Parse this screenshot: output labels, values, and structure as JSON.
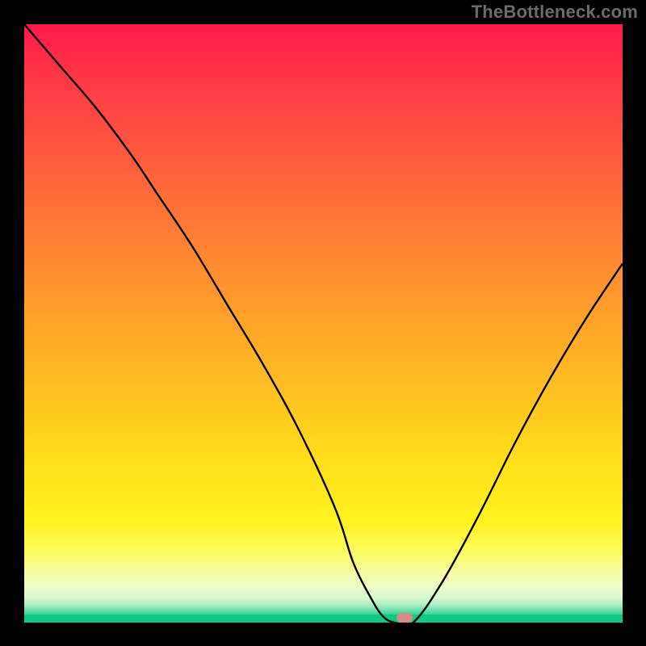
{
  "watermark": "TheBottleneck.com",
  "chart_data": {
    "type": "line",
    "title": "",
    "xlabel": "",
    "ylabel": "",
    "xlim": [
      0,
      100
    ],
    "ylim": [
      0,
      100
    ],
    "series": [
      {
        "name": "bottleneck-curve",
        "x": [
          0,
          6,
          12,
          18,
          22,
          28,
          34,
          40,
          46,
          52,
          55,
          58,
          60,
          62,
          65,
          70,
          76,
          82,
          88,
          94,
          100
        ],
        "values": [
          100,
          93,
          86,
          78,
          72,
          63,
          53,
          43,
          32,
          19,
          10,
          4,
          1,
          0,
          0,
          7,
          18,
          30,
          41,
          51,
          60
        ]
      }
    ],
    "marker": {
      "x": 63.5,
      "y": 0.8
    },
    "background": {
      "type": "vertical-gradient",
      "stops": [
        {
          "pos": 0.0,
          "color": "#ff1a4b"
        },
        {
          "pos": 0.5,
          "color": "#ffb823"
        },
        {
          "pos": 0.85,
          "color": "#fff31f"
        },
        {
          "pos": 0.97,
          "color": "#86e5b6"
        },
        {
          "pos": 1.0,
          "color": "#0fcb82"
        }
      ]
    }
  }
}
